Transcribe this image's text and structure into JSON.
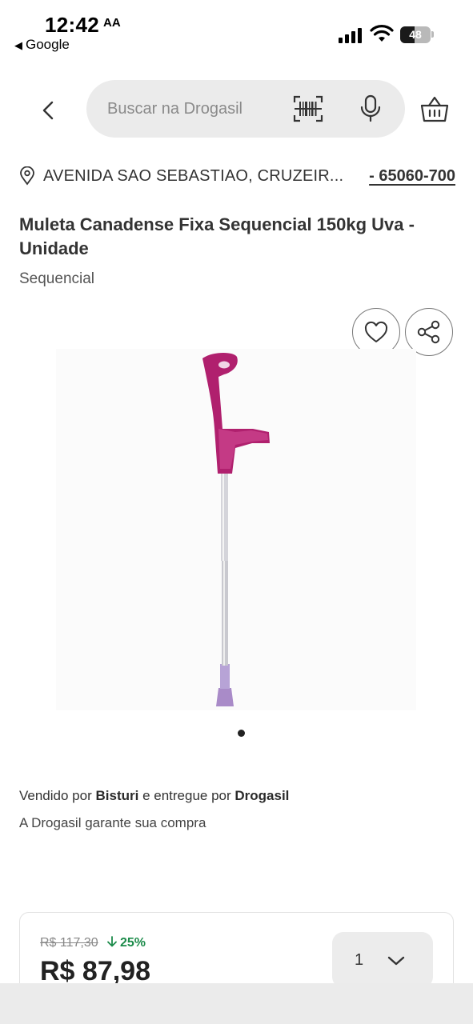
{
  "status_bar": {
    "time": "12:42",
    "app_icon_text": "AA",
    "back_app": "Google",
    "battery": "48",
    "battery_level": 0.48
  },
  "header": {
    "search_placeholder": "Buscar na Drogasil"
  },
  "address": {
    "street": "AVENIDA SAO SEBASTIAO, CRUZEIR...",
    "cep": "- 65060-700"
  },
  "product": {
    "title": "Muleta Canadense Fixa Sequencial 150kg Uva - Unidade",
    "brand": "Sequencial",
    "carousel_count": 1,
    "image_color": "#b0206e"
  },
  "seller": {
    "sold_by_prefix": "Vendido por",
    "seller_name": "Bisturi",
    "delivered_by_prefix": "e entregue por",
    "delivery_name": "Drogasil",
    "guarantee": "A Drogasil garante sua compra"
  },
  "pricing": {
    "old_price": "R$ 117,30",
    "discount": "25%",
    "price": "R$ 87,98",
    "quantity": "1",
    "discount_color": "#1c8b4a"
  }
}
